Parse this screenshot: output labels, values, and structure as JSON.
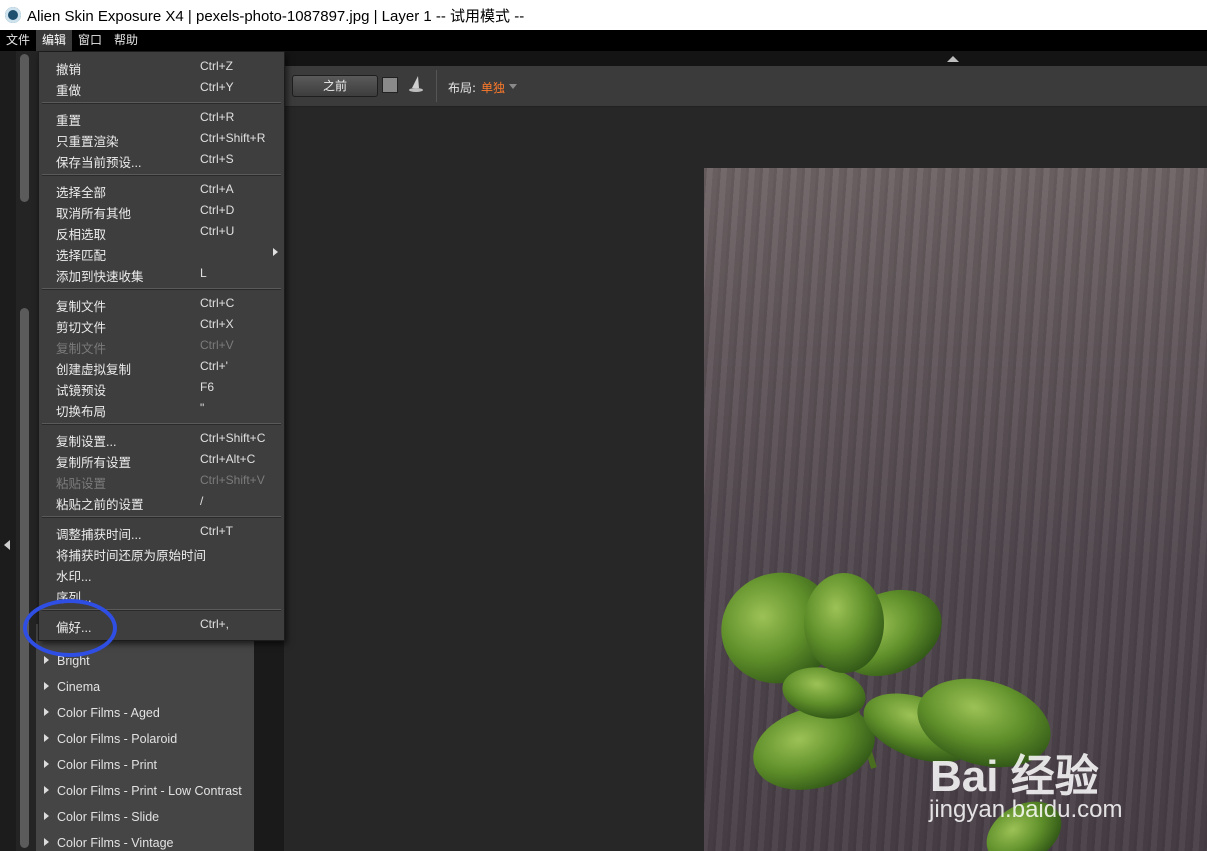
{
  "window": {
    "title": "Alien Skin Exposure X4 | pexels-photo-1087897.jpg | Layer 1 -- 试用模式 --"
  },
  "menubar": [
    {
      "label": "文件"
    },
    {
      "label": "编辑"
    },
    {
      "label": "窗口"
    },
    {
      "label": "帮助"
    }
  ],
  "edit_menu": {
    "items": [
      {
        "label": "撤销",
        "shortcut": "Ctrl+Z"
      },
      {
        "label": "重做",
        "shortcut": "Ctrl+Y"
      },
      {
        "label": "重置",
        "shortcut": "Ctrl+R"
      },
      {
        "label": "只重置渲染",
        "shortcut": "Ctrl+Shift+R"
      },
      {
        "label": "保存当前预设...",
        "shortcut": "Ctrl+S"
      },
      {
        "label": "选择全部",
        "shortcut": "Ctrl+A"
      },
      {
        "label": "取消所有其他",
        "shortcut": "Ctrl+D"
      },
      {
        "label": "反相选取",
        "shortcut": "Ctrl+U"
      },
      {
        "label": "选择匹配",
        "shortcut": ""
      },
      {
        "label": "添加到快速收集",
        "shortcut": "L"
      },
      {
        "label": "复制文件",
        "shortcut": "Ctrl+C"
      },
      {
        "label": "剪切文件",
        "shortcut": "Ctrl+X"
      },
      {
        "label": "复制文件",
        "shortcut": "Ctrl+V"
      },
      {
        "label": "创建虚拟复制",
        "shortcut": "Ctrl+'"
      },
      {
        "label": "试镜预设",
        "shortcut": "F6"
      },
      {
        "label": "切换布局",
        "shortcut": "\""
      },
      {
        "label": "复制设置...",
        "shortcut": "Ctrl+Shift+C"
      },
      {
        "label": "复制所有设置",
        "shortcut": "Ctrl+Alt+C"
      },
      {
        "label": "粘贴设置",
        "shortcut": "Ctrl+Shift+V"
      },
      {
        "label": "粘贴之前的设置",
        "shortcut": "/"
      },
      {
        "label": "调整捕获时间...",
        "shortcut": "Ctrl+T"
      },
      {
        "label": "将捕获时间还原为原始时间",
        "shortcut": ""
      },
      {
        "label": "水印...",
        "shortcut": ""
      },
      {
        "label": "序列...",
        "shortcut": ""
      },
      {
        "label": "偏好...",
        "shortcut": "Ctrl+,"
      }
    ]
  },
  "toolbar": {
    "before_label": "之前",
    "layout_label": "布局:",
    "layout_value": "单独",
    "accent_color": "#ff7a2a"
  },
  "presets": [
    {
      "label": "Bright"
    },
    {
      "label": "Cinema"
    },
    {
      "label": "Color Films - Aged"
    },
    {
      "label": "Color Films - Polaroid"
    },
    {
      "label": "Color Films - Print"
    },
    {
      "label": "Color Films - Print - Low Contrast"
    },
    {
      "label": "Color Films - Slide"
    },
    {
      "label": "Color Films - Vintage"
    }
  ],
  "watermark": {
    "brand": "Bai  经验",
    "url": "jingyan.baidu.com"
  },
  "annotation": {
    "ring_color": "#2f4ee3"
  }
}
